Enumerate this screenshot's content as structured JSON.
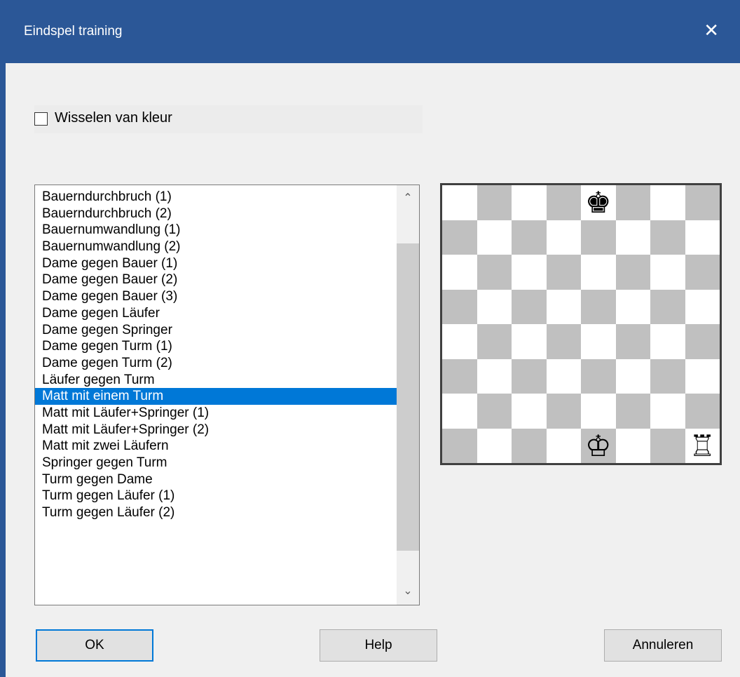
{
  "window": {
    "title": "Eindspel training",
    "close_glyph": "✕"
  },
  "options": {
    "swap_colors_label": "Wisselen van kleur",
    "swap_colors_checked": false
  },
  "endgames": {
    "items": [
      "Bauerndurchbruch (1)",
      "Bauerndurchbruch (2)",
      "Bauernumwandlung (1)",
      "Bauernumwandlung (2)",
      "Dame gegen Bauer (1)",
      "Dame gegen Bauer (2)",
      "Dame gegen Bauer (3)",
      "Dame gegen Läufer",
      "Dame gegen Springer",
      "Dame gegen Turm (1)",
      "Dame gegen Turm (2)",
      "Läufer gegen Turm",
      "Matt mit einem Turm",
      "Matt mit Läufer+Springer (1)",
      "Matt mit Läufer+Springer (2)",
      "Matt mit zwei Läufern",
      "Springer gegen Turm",
      "Turm gegen Dame",
      "Turm gegen Läufer (1)",
      "Turm gegen Läufer (2)"
    ],
    "selected_index": 12,
    "scroll_up_glyph": "⌃",
    "scroll_down_glyph": "⌄"
  },
  "board": {
    "colors": {
      "light": "#ffffff",
      "dark": "#c0c0c0"
    },
    "pieces": [
      {
        "square": "e8",
        "piece": "black-king",
        "glyph": "♚"
      },
      {
        "square": "e1",
        "piece": "white-king",
        "glyph": "♔"
      },
      {
        "square": "h1",
        "piece": "white-rook",
        "glyph": "♖"
      }
    ]
  },
  "buttons": {
    "ok": "OK",
    "help": "Help",
    "cancel": "Annuleren"
  },
  "colors": {
    "titlebar": "#2b5797",
    "selection": "#0078d7"
  }
}
